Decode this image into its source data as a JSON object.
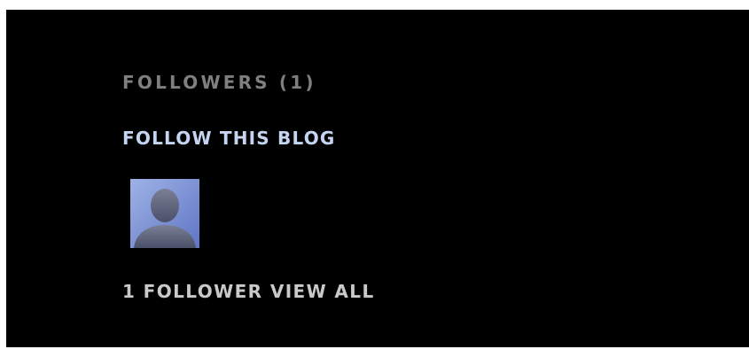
{
  "followers_widget": {
    "title": "FOLLOWERS (1)",
    "follow_label": "FOLLOW THIS BLOG",
    "follower_count_label": "1 FOLLOWER",
    "view_all_label": "VIEW ALL",
    "avatar_icon": "default-user-silhouette-icon"
  },
  "colors": {
    "background": "#000000",
    "title": "#7f7f7f",
    "link": "#c5d4f1",
    "footer": "#c9c9c9"
  }
}
